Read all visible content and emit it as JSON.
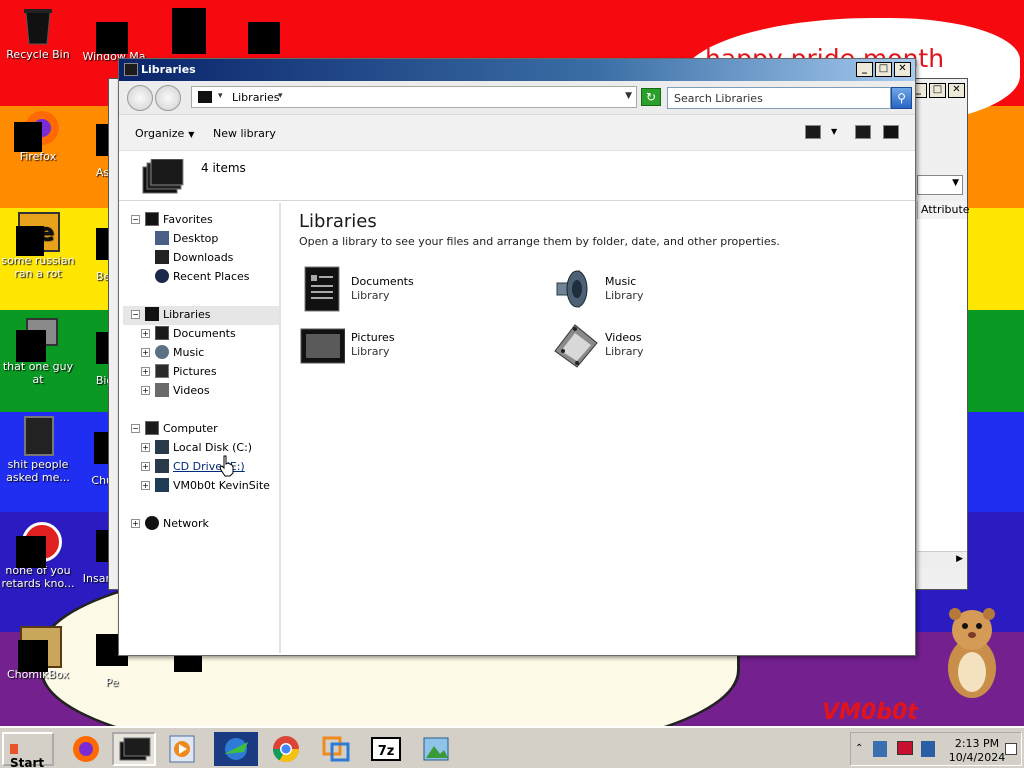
{
  "desktop": {
    "speech_text": "happy pride month",
    "watermark_text": "VM0b0t",
    "icons": [
      {
        "label": "Recycle Bin"
      },
      {
        "label": "Firefox"
      },
      {
        "label": "some russian ran a rot"
      },
      {
        "label": "that one guy at"
      },
      {
        "label": "shit people asked me..."
      },
      {
        "label": "none of you retards kno..."
      },
      {
        "label": "ChomikBox"
      },
      {
        "label": "Window Ma"
      },
      {
        "label": "Ast De"
      },
      {
        "label": "Bea Di"
      },
      {
        "label": "Big De"
      },
      {
        "label": "Chuzz"
      },
      {
        "label": "Insan Delu"
      },
      {
        "label": "Pe"
      }
    ]
  },
  "background_window": {
    "column_header": "Attribute"
  },
  "window": {
    "title": "Libraries",
    "controls": {
      "minimize": "_",
      "maximize": "□",
      "close": "✕"
    },
    "address": {
      "crumb": "Libraries"
    },
    "search_placeholder": "Search Libraries",
    "toolbar": {
      "organize": "Organize",
      "new_library": "New library"
    },
    "preview": {
      "count": "4 items"
    },
    "nav": {
      "favorites": "Favorites",
      "desktop": "Desktop",
      "downloads": "Downloads",
      "recent_places": "Recent Places",
      "libraries": "Libraries",
      "documents": "Documents",
      "music": "Music",
      "pictures": "Pictures",
      "videos": "Videos",
      "computer": "Computer",
      "local_disk": "Local Disk (C:)",
      "cd_drive": "CD Drive (E:)",
      "vm_site": "VM0b0t KevinSite",
      "network": "Network"
    },
    "content": {
      "title": "Libraries",
      "description": "Open a library to see your files and arrange them by folder, date, and other properties.",
      "libraries": [
        {
          "name": "Documents",
          "type": "Library",
          "icon": "documents-library-icon"
        },
        {
          "name": "Music",
          "type": "Library",
          "icon": "music-library-icon"
        },
        {
          "name": "Pictures",
          "type": "Library",
          "icon": "pictures-library-icon"
        },
        {
          "name": "Videos",
          "type": "Library",
          "icon": "videos-library-icon"
        }
      ]
    }
  },
  "taskbar": {
    "start": "Start",
    "time": "2:13 PM",
    "date": "10/4/2024"
  },
  "colors": {
    "title_gradient_start": "#0a246a",
    "title_gradient_end": "#a6caf0",
    "taskbar": "#d4d0c8"
  }
}
